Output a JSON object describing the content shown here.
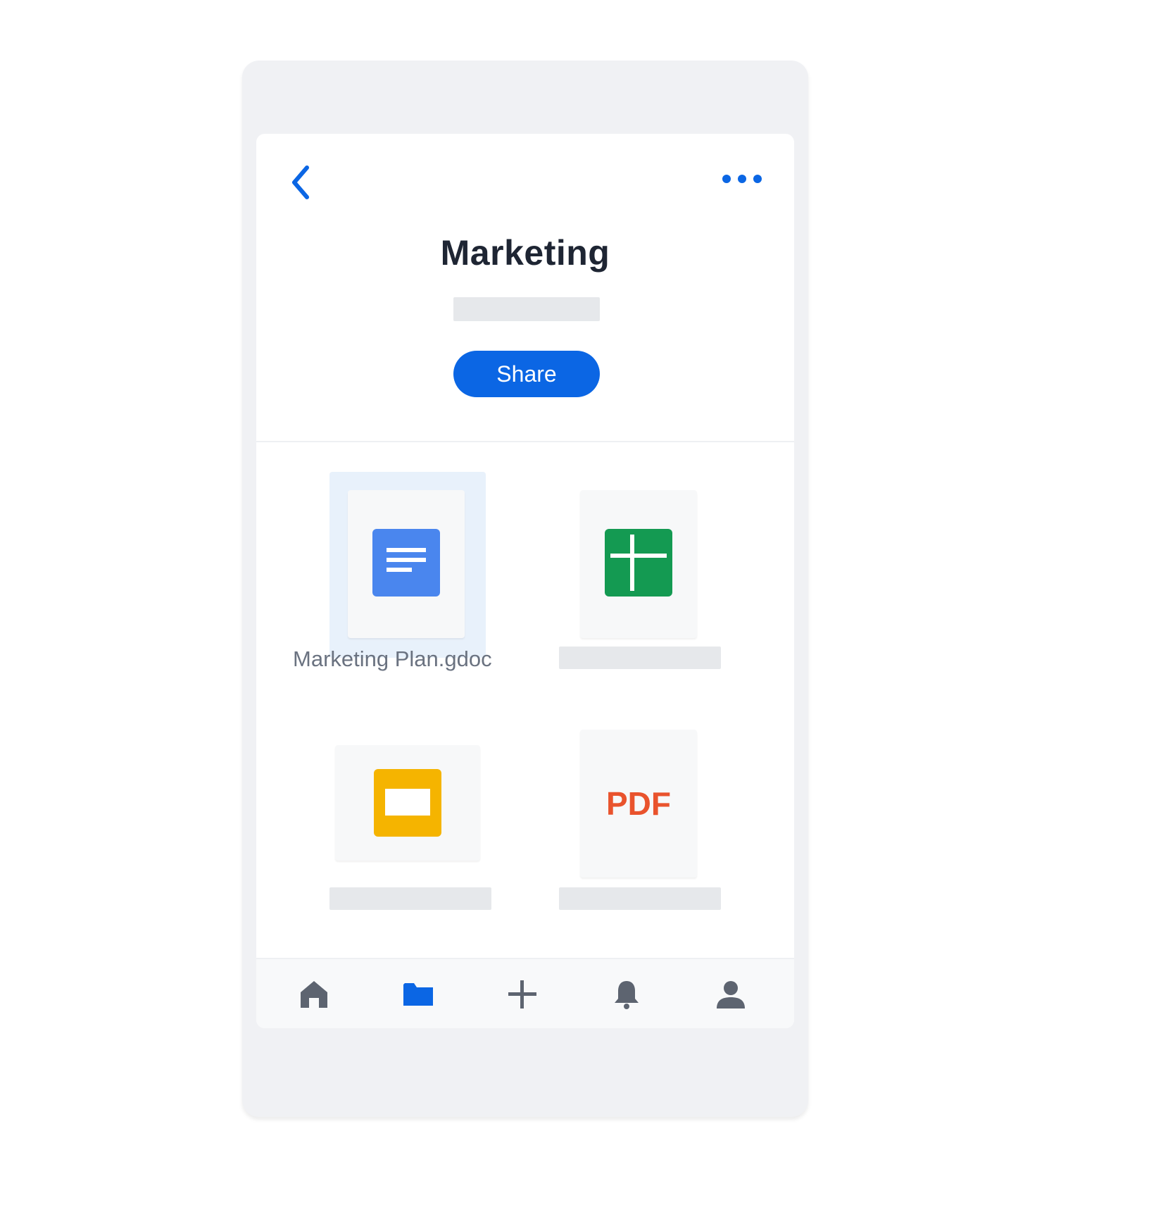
{
  "folder": {
    "title": "Marketing",
    "share_label": "Share"
  },
  "files": [
    {
      "name": "Marketing Plan.gdoc",
      "type": "google-doc",
      "icon": "google-docs-icon",
      "color": "#4a86ee",
      "selected": true
    },
    {
      "name": "",
      "type": "google-sheet",
      "icon": "google-sheets-icon",
      "color": "#149a52",
      "selected": false
    },
    {
      "name": "",
      "type": "google-slides",
      "icon": "google-slides-icon",
      "color": "#f5b400",
      "selected": false
    },
    {
      "name": "",
      "type": "pdf",
      "icon": "pdf-icon",
      "badge": "PDF",
      "color": "#e9532d",
      "selected": false
    }
  ],
  "tabs": [
    {
      "name": "home",
      "icon": "home-icon",
      "active": false
    },
    {
      "name": "files",
      "icon": "folder-icon",
      "active": true
    },
    {
      "name": "create",
      "icon": "plus-icon",
      "active": false
    },
    {
      "name": "notifications",
      "icon": "bell-icon",
      "active": false
    },
    {
      "name": "account",
      "icon": "person-icon",
      "active": false
    }
  ],
  "colors": {
    "accent": "#0b66e4",
    "tab_inactive": "#5d6470",
    "title": "#1e2533"
  }
}
